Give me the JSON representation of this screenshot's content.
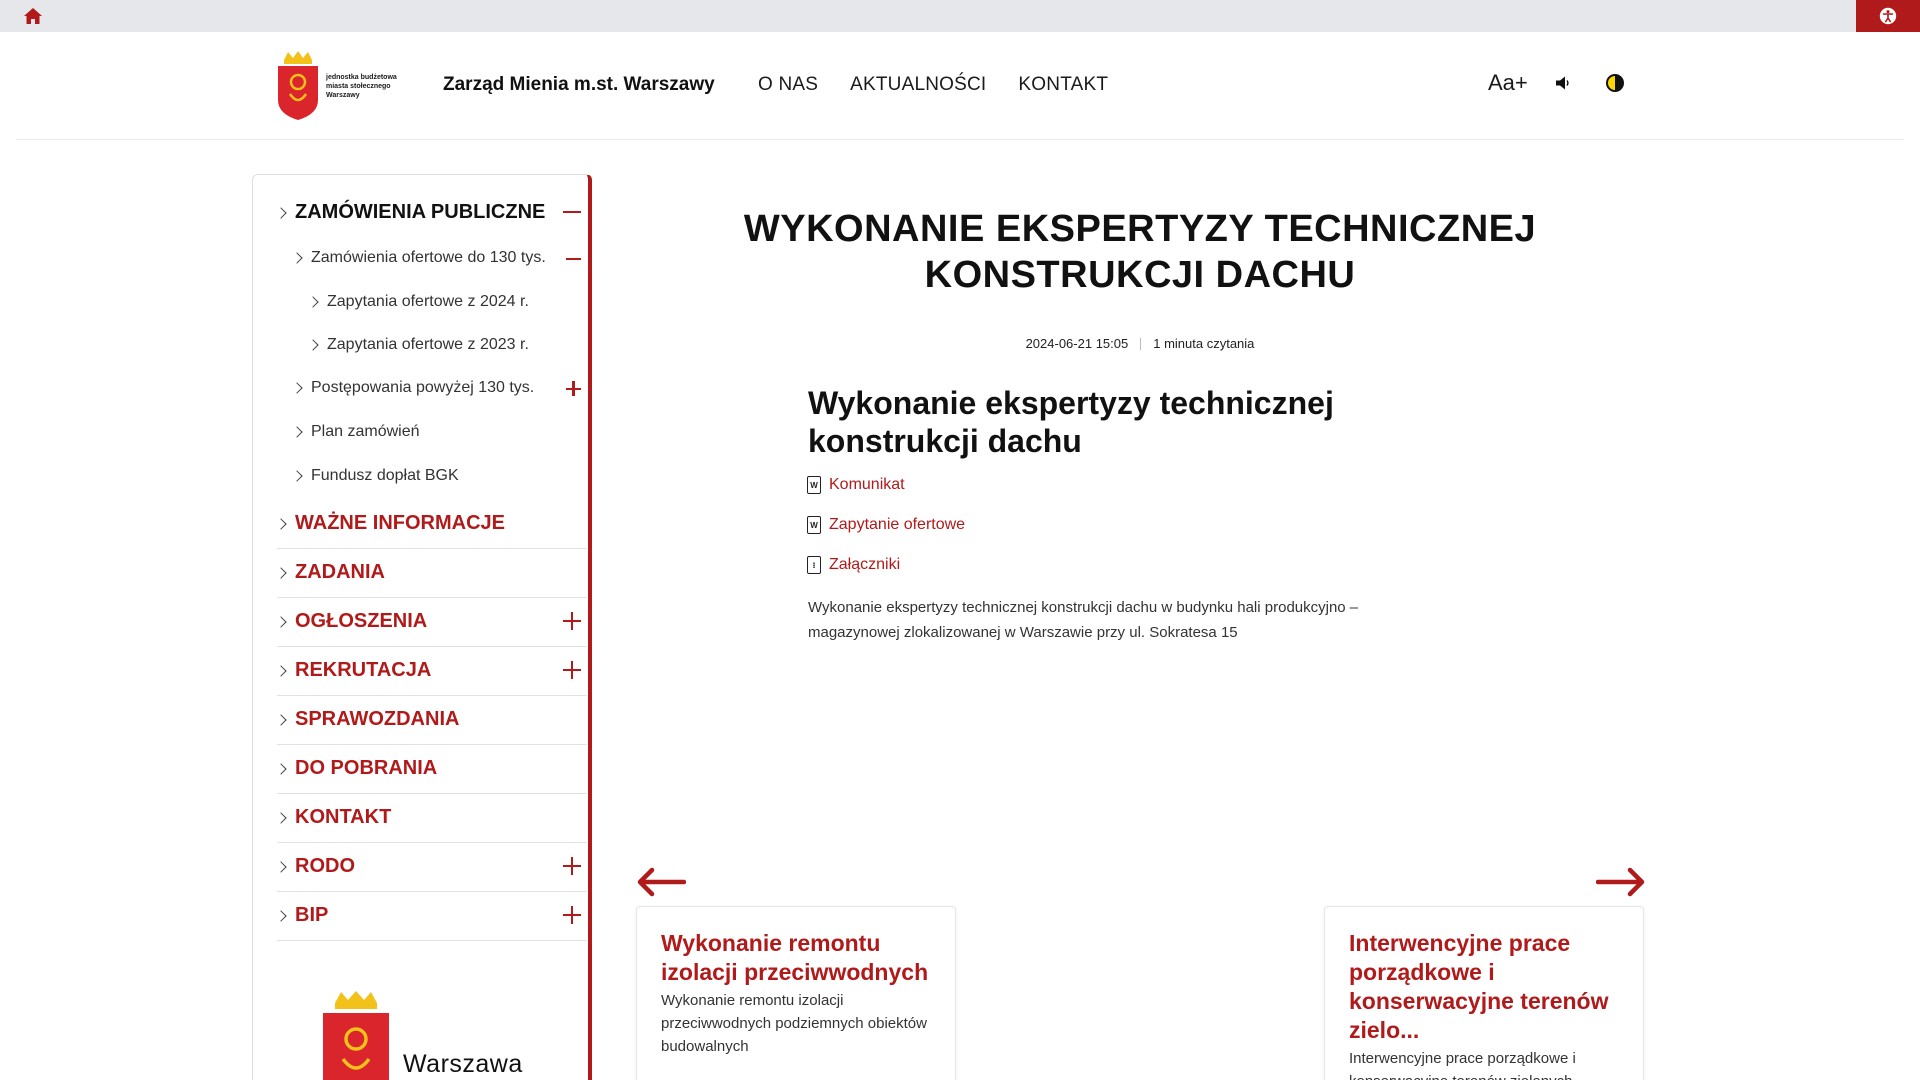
{
  "header": {
    "logo_text": [
      "jednostka budżetowa",
      "miasta stołecznego",
      "Warszawy"
    ],
    "org_title": "Zarząd Mienia m.st. Warszawy",
    "nav": [
      "O NAS",
      "AKTUALNOŚCI",
      "KONTAKT"
    ],
    "font_tool": "Aa+"
  },
  "sidebar": {
    "items": [
      {
        "label": "ZAMÓWIENIA PUBLICZNE",
        "level": 1,
        "toggle": "minus"
      },
      {
        "label": "Zamówienia ofertowe do 130 tys.",
        "level": 2,
        "toggle": "minus"
      },
      {
        "label": "Zapytania ofertowe z 2024 r.",
        "level": 3
      },
      {
        "label": "Zapytania ofertowe z 2023 r.",
        "level": 3
      },
      {
        "label": "Postępowania powyżej 130 tys.",
        "level": 2,
        "toggle": "plus"
      },
      {
        "label": "Plan zamówień",
        "level": 2
      },
      {
        "label": "Fundusz dopłat BGK",
        "level": 2
      },
      {
        "label": "WAŻNE INFORMACJE",
        "level": 1
      },
      {
        "label": "ZADANIA",
        "level": 1
      },
      {
        "label": "OGŁOSZENIA",
        "level": 1,
        "toggle": "plus"
      },
      {
        "label": "REKRUTACJA",
        "level": 1,
        "toggle": "plus"
      },
      {
        "label": "SPRAWOZDANIA",
        "level": 1
      },
      {
        "label": "DO POBRANIA",
        "level": 1
      },
      {
        "label": "KONTAKT",
        "level": 1
      },
      {
        "label": "RODO",
        "level": 1,
        "toggle": "plus"
      },
      {
        "label": "BIP",
        "level": 1,
        "toggle": "plus"
      }
    ],
    "logo_text": "Warszawa"
  },
  "article": {
    "title": "WYKONANIE EKSPERTYZY TECHNICZNEJ KONSTRUKCJI DACHU",
    "date": "2024-06-21 15:05",
    "reading_time": "1 minuta czytania",
    "content_title": "Wykonanie ekspertyzy technicznej konstrukcji dachu",
    "files": [
      {
        "label": "Komunikat",
        "icon": "word-doc-icon",
        "glyph": "W"
      },
      {
        "label": "Zapytanie ofertowe",
        "icon": "word-doc-icon",
        "glyph": "W"
      },
      {
        "label": "Załączniki",
        "icon": "zip-file-icon",
        "glyph": "⁝"
      }
    ],
    "description": "Wykonanie ekspertyzy technicznej konstrukcji dachu w budynku hali produkcyjno – magazynowej zlokalizowanej w Warszawie przy ul. Sokratesa 15"
  },
  "related": {
    "prev": {
      "title": "Wykonanie remontu izolacji przeciwwodnych",
      "excerpt": "Wykonanie remontu izolacji przeciwwodnych podziemnych obiektów budowalnych"
    },
    "next": {
      "title": "Interwencyjne prace porządkowe i konserwacyjne terenów zielo...",
      "excerpt": "Interwencyjne prace porządkowe i konserwacyjne terenów zielonych"
    }
  },
  "colors": {
    "accent": "#b01a1a",
    "topbar": "#e6e7eb"
  }
}
